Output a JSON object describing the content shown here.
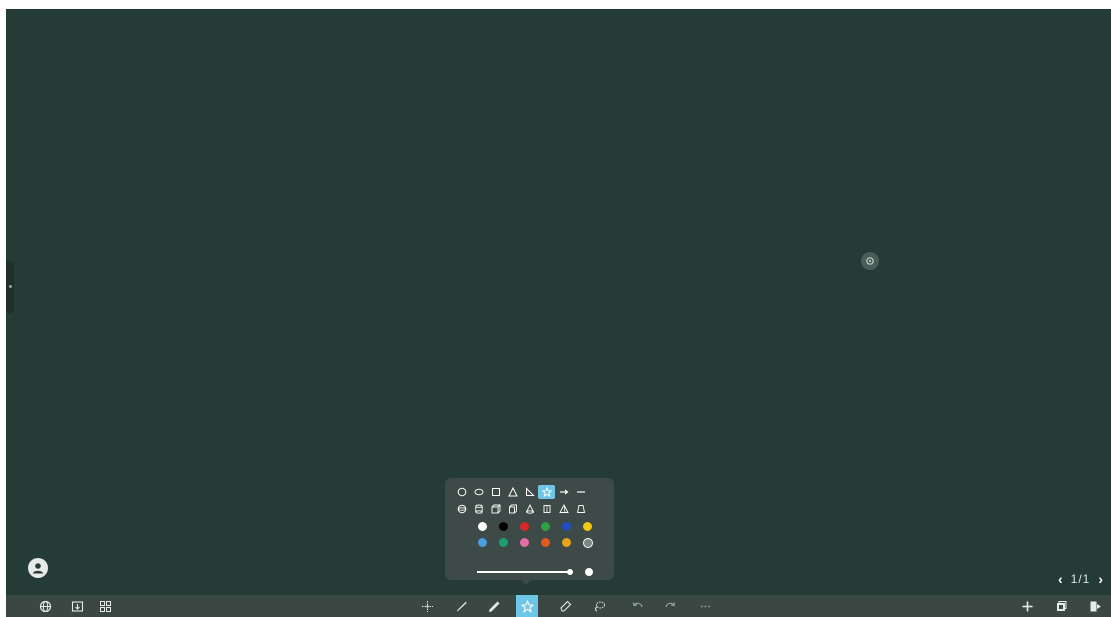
{
  "canvas": {
    "background_color": "#253b36"
  },
  "pagination": {
    "prev_icon": "chevron-left-icon",
    "page_text": "1/1",
    "next_icon": "chevron-right-icon"
  },
  "shape_panel": {
    "shapes_row1": [
      "circle-icon",
      "ellipse-icon",
      "square-icon",
      "triangle-icon",
      "right-triangle-icon",
      "star-icon",
      "arrow-icon",
      "line-icon"
    ],
    "shapes_row2": [
      "sphere-icon",
      "cylinder-icon",
      "cube-icon",
      "cuboid-icon",
      "cone-icon",
      "prism-icon",
      "pyramid-icon",
      "frustum-icon"
    ],
    "selected_shape": "star-icon",
    "colors_row1": [
      "#ffffff",
      "#000000",
      "#d62828",
      "#2ea043",
      "#1f4fbf",
      "#f2c811"
    ],
    "colors_row2": [
      "#4a9fe0",
      "#1f9e6d",
      "#e36fa5",
      "#e05a1c",
      "#e8a317"
    ],
    "custom_color_icon": "color-picker-icon",
    "stroke_width_percent": 100
  },
  "toolbar": {
    "left_icons": [
      "globe-icon",
      "import-icon",
      "grid-icon"
    ],
    "center_icons": [
      "move-icon",
      "pen-icon",
      "highlighter-icon",
      "shape-icon",
      "eraser-icon",
      "lasso-icon",
      "undo-icon",
      "redo-icon",
      "more-icon"
    ],
    "active_tool": "shape-icon",
    "right_icons": [
      "add-page-icon",
      "page-preview-icon",
      "exit-icon"
    ]
  },
  "accent_color": "#6ec6e6"
}
